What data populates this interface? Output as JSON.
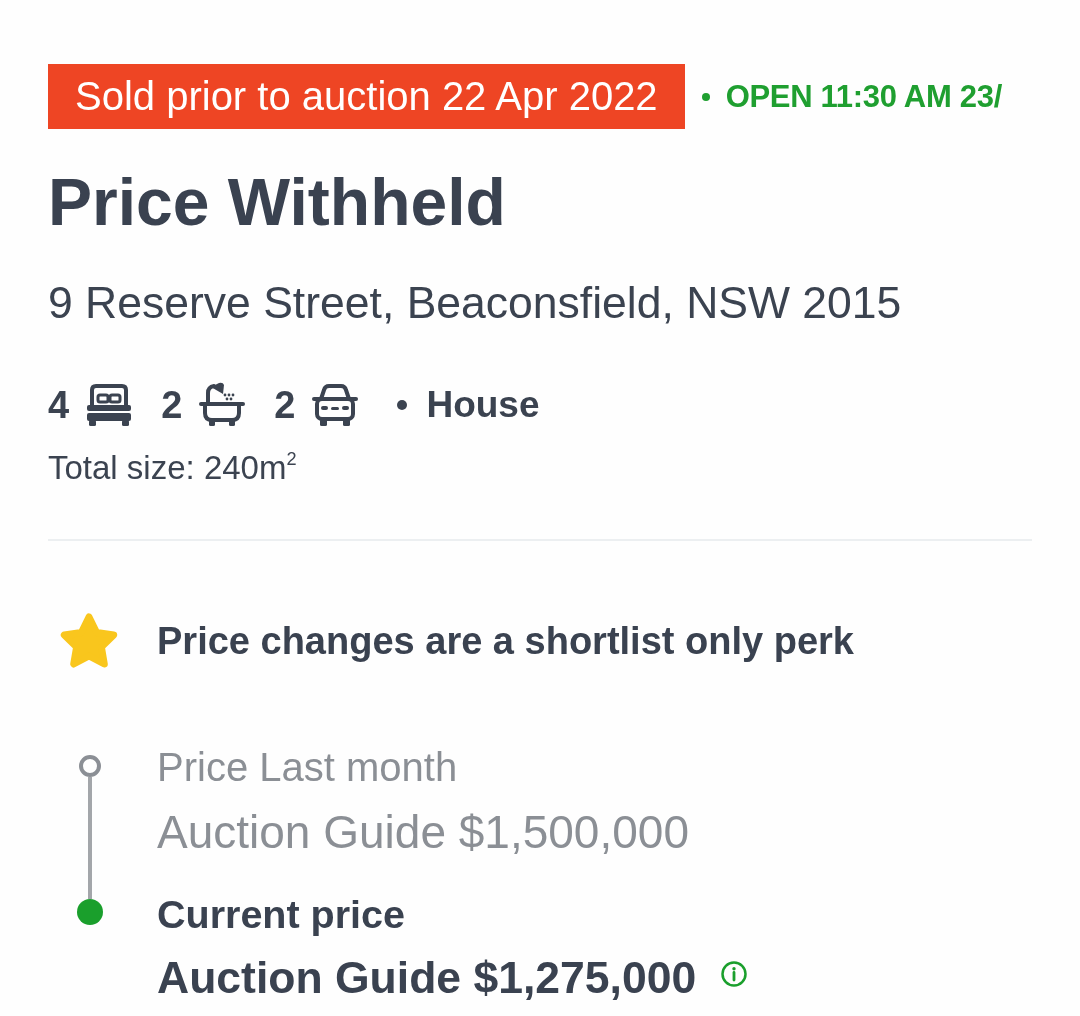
{
  "listing_status": {
    "sold_badge": "Sold prior to auction 22 Apr 2022",
    "inspection": "OPEN 11:30 AM 23/"
  },
  "price": "Price Withheld",
  "address": "9 Reserve Street, Beaconsfield, NSW 2015",
  "features": [
    {
      "kind": "bed",
      "count": "4"
    },
    {
      "kind": "bath",
      "count": "2"
    },
    {
      "kind": "car",
      "count": "2"
    }
  ],
  "property_type": "House",
  "total_size": "Total size: 240m$^{2}$",
  "perk_notice": "Price changes are a shortlist only perk",
  "price_history": [
    {
      "label": "Price Last month",
      "value": "Auction Guide $1,500,000",
      "current": false,
      "info": false
    },
    {
      "label": "Current price",
      "value": "Auction Guide $1,275,000",
      "current": true,
      "info": true
    }
  ]
}
